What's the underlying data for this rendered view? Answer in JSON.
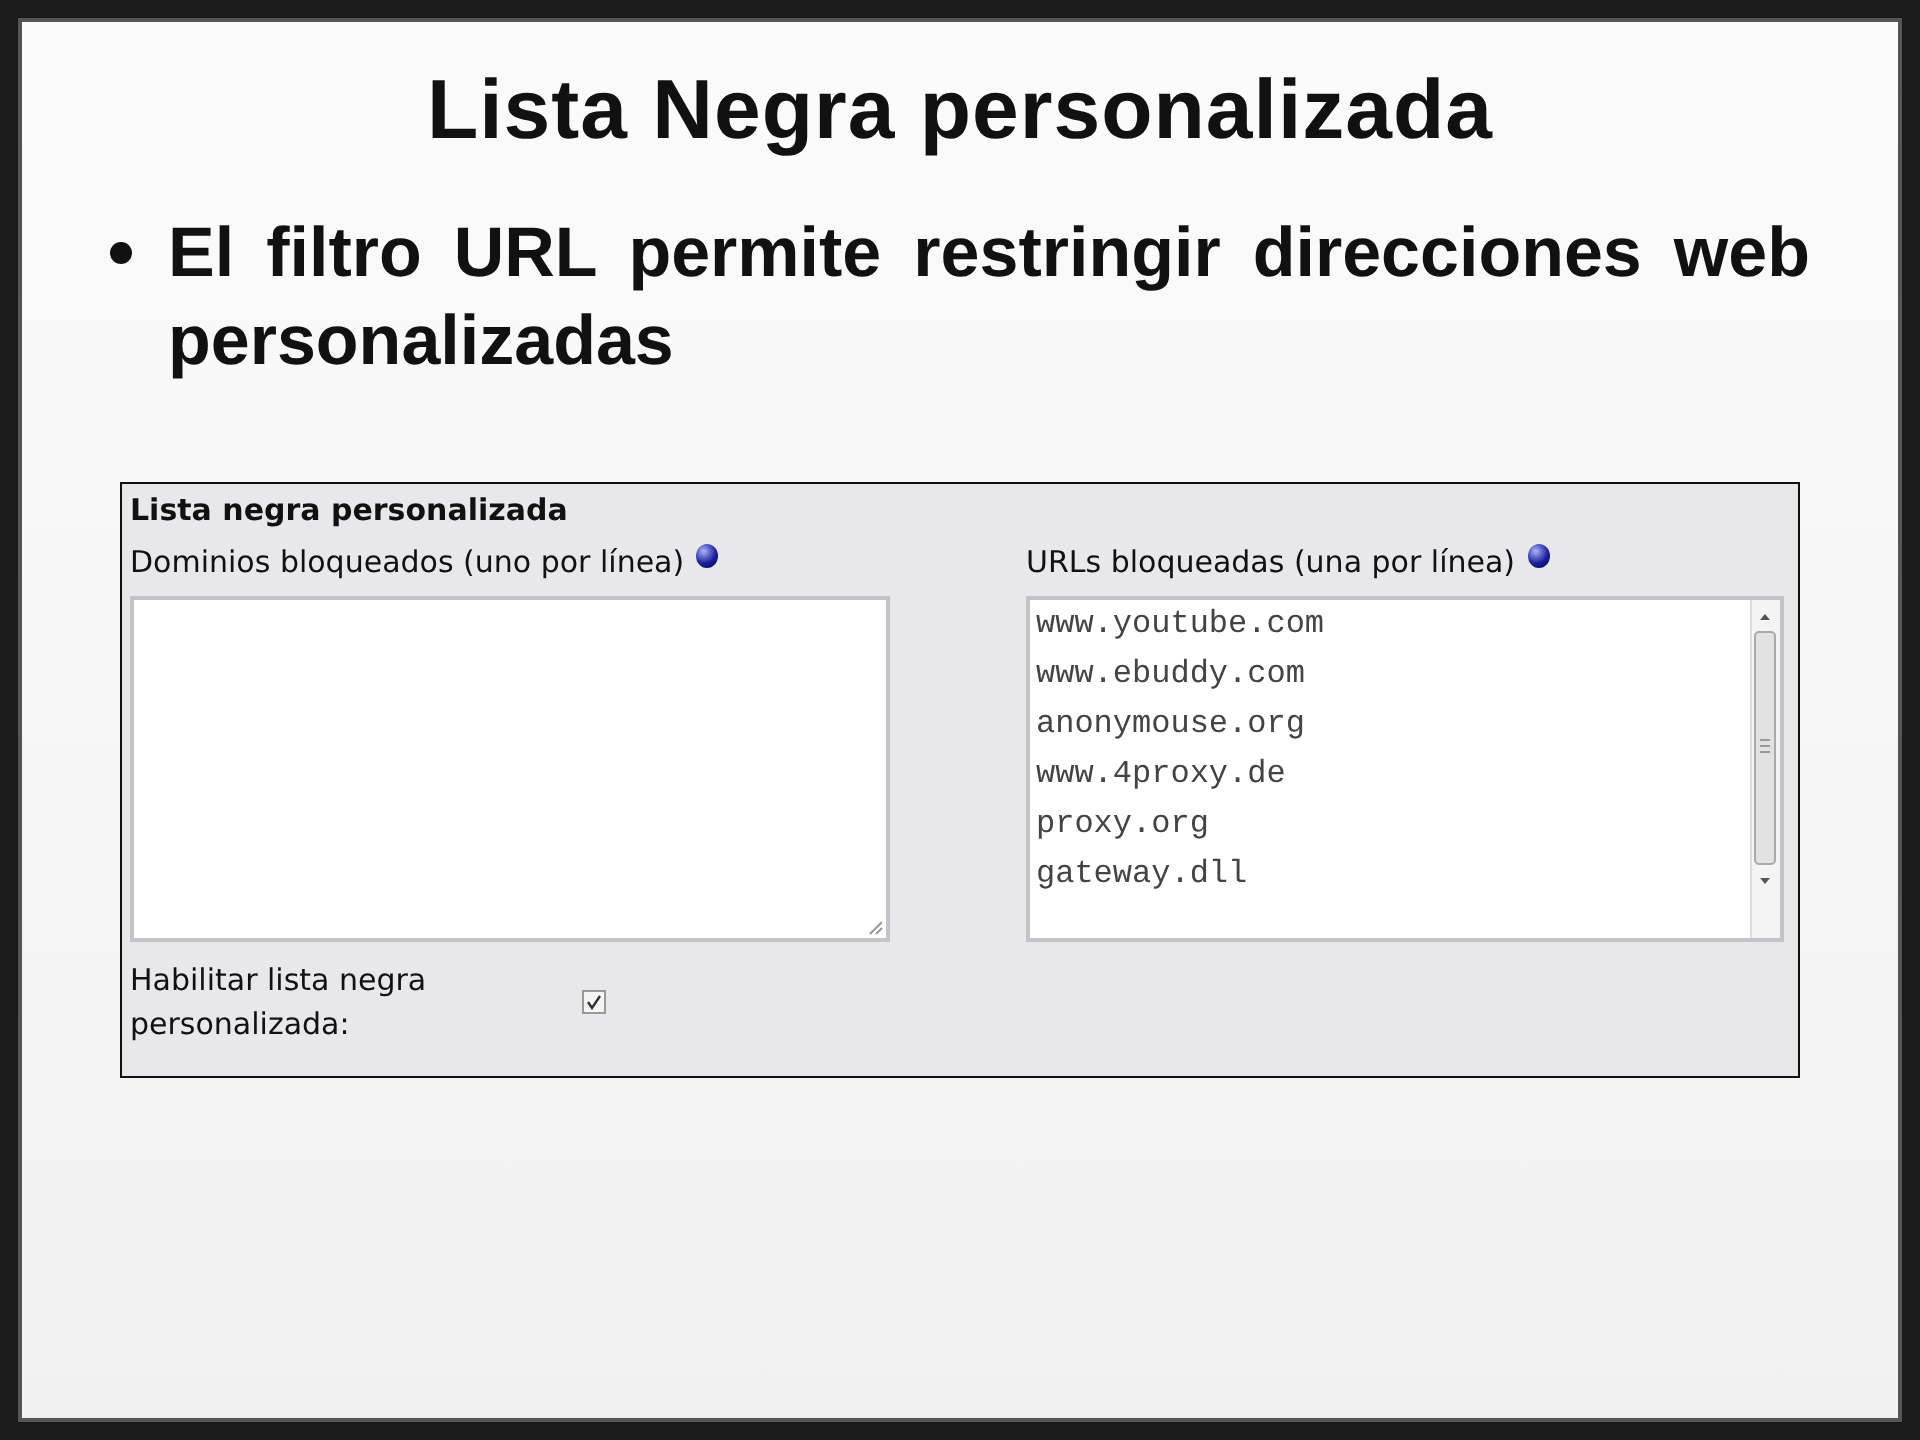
{
  "slide": {
    "title": "Lista Negra personalizada",
    "bullets": [
      "El filtro URL permite restringir direcciones web personalizadas"
    ]
  },
  "panel": {
    "title": "Lista negra personalizada",
    "domains": {
      "label": "Dominios bloqueados (uno por línea)"
    },
    "urls": {
      "label": "URLs bloqueadas (una por línea)",
      "lines": [
        "www.youtube.com",
        "www.ebuddy.com",
        "anonymouse.org",
        "www.4proxy.de",
        "proxy.org",
        "gateway.dll"
      ]
    },
    "enable": {
      "label": "Habilitar lista negra personalizada:",
      "checked": true
    }
  }
}
